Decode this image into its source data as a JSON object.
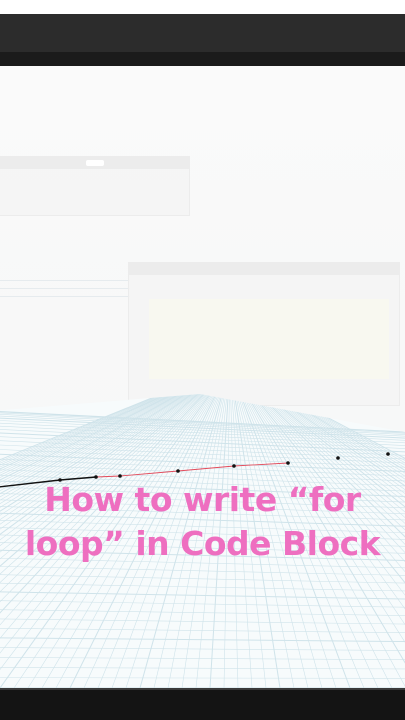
{
  "video": {
    "caption_line_1": "How to write “for",
    "caption_line_2": "loop” in Code Block",
    "caption_color": "#ee6fc0"
  },
  "colors": {
    "top_bar": "#2c2c2c",
    "bottom_bar": "#141414",
    "grid": "#cfe3ea",
    "curve_black": "#111111",
    "curve_red": "#e24a5a"
  }
}
